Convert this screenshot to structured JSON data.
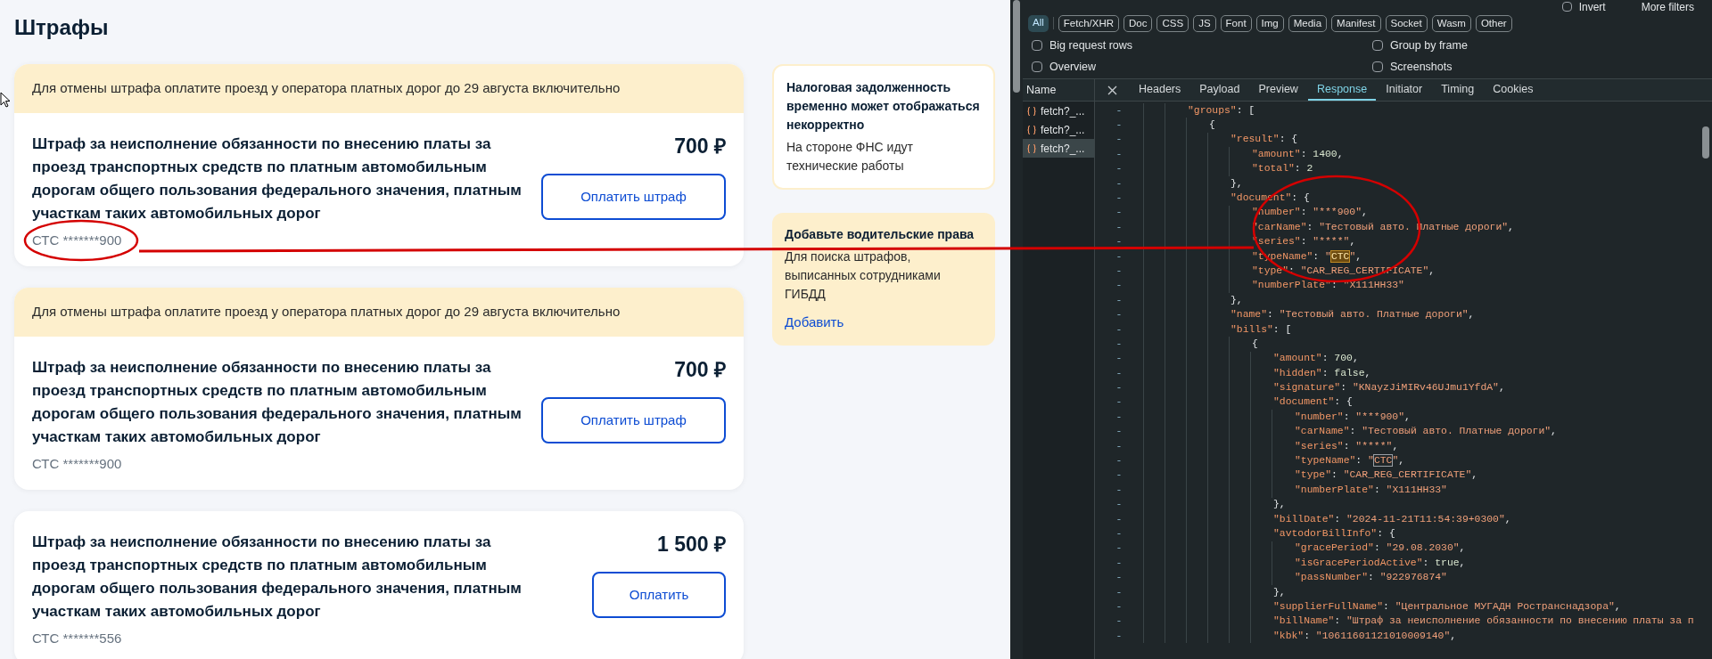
{
  "page": {
    "title": "Штрафы",
    "fines": [
      {
        "banner": "Для отмены штрафа оплатите проезд у оператора платных дорог до 29 августа включительно",
        "title": "Штраф за неисполнение обязанности по внесению платы за проезд транспортных средств по платным автомобильным дорогам общего пользования федерального значения, платным участкам таких автомобильных дорог",
        "amount": "700 ₽",
        "button": "Оплатить штраф",
        "document": "СТС *******900"
      },
      {
        "banner": "Для отмены штрафа оплатите проезд у оператора платных дорог до 29 августа включительно",
        "title": "Штраф за неисполнение обязанности по внесению платы за проезд транспортных средств по платным автомобильным дорогам общего пользования федерального значения, платным участкам таких автомобильных дорог",
        "amount": "700 ₽",
        "button": "Оплатить штраф",
        "document": "СТС *******900"
      },
      {
        "title": "Штраф за неисполнение обязанности по внесению платы за проезд транспортных средств по платным автомобильным дорогам общего пользования федерального значения, платным участкам таких автомобильных дорог",
        "amount": "1 500 ₽",
        "button": "Оплатить",
        "document": "СТС *******556"
      }
    ],
    "side_cards": [
      {
        "kind": "notice",
        "title": "Налоговая задолженность временно может отображаться некорректно",
        "text": "На стороне ФНС идут технические работы"
      },
      {
        "kind": "action",
        "title": "Добавьте водительские права",
        "text": "Для поиска штрафов, выписанных сотрудниками ГИБДД",
        "link": "Добавить"
      }
    ]
  },
  "devtools": {
    "filter": {
      "invert": {
        "label": "Invert",
        "checked": false
      },
      "more_filters": "More filters"
    },
    "type_filters": [
      {
        "label": "All",
        "selected": true
      },
      {
        "label": "Fetch/XHR",
        "selected": false
      },
      {
        "label": "Doc",
        "selected": false
      },
      {
        "label": "CSS",
        "selected": false
      },
      {
        "label": "JS",
        "selected": false
      },
      {
        "label": "Font",
        "selected": false
      },
      {
        "label": "Img",
        "selected": false
      },
      {
        "label": "Media",
        "selected": false
      },
      {
        "label": "Manifest",
        "selected": false
      },
      {
        "label": "Socket",
        "selected": false
      },
      {
        "label": "Wasm",
        "selected": false
      },
      {
        "label": "Other",
        "selected": false
      }
    ],
    "options": [
      {
        "label": "Big request rows",
        "checked": false
      },
      {
        "label": "Group by frame",
        "checked": false
      },
      {
        "label": "Overview",
        "checked": false
      },
      {
        "label": "Screenshots",
        "checked": false
      }
    ],
    "name_header": "Name",
    "requests": [
      {
        "name": "fetch?_...",
        "selected": false
      },
      {
        "name": "fetch?_...",
        "selected": false
      },
      {
        "name": "fetch?_...",
        "selected": true
      }
    ],
    "tabs": [
      {
        "label": "Headers",
        "selected": false
      },
      {
        "label": "Payload",
        "selected": false
      },
      {
        "label": "Preview",
        "selected": false
      },
      {
        "label": "Response",
        "selected": true
      },
      {
        "label": "Initiator",
        "selected": false
      },
      {
        "label": "Timing",
        "selected": false
      },
      {
        "label": "Cookies",
        "selected": false
      }
    ],
    "response_lines": [
      {
        "gutter": "-",
        "tokens": [
          {
            "kind": "key",
            "text": "\"groups\""
          },
          {
            "kind": "punct",
            "text": ": ["
          }
        ],
        "children": [
          {
            "gutter": "-",
            "tokens": [
              {
                "kind": "punct",
                "text": "{"
              }
            ],
            "children": [
              {
                "gutter": "-",
                "tokens": [
                  {
                    "kind": "key",
                    "text": "\"result\""
                  },
                  {
                    "kind": "punct",
                    "text": ": {"
                  }
                ],
                "children": [
                  {
                    "gutter": "-",
                    "tokens": [
                      {
                        "kind": "key",
                        "text": "\"amount\""
                      },
                      {
                        "kind": "punct",
                        "text": ": "
                      },
                      {
                        "kind": "number",
                        "text": "1400"
                      },
                      {
                        "kind": "punct",
                        "text": ","
                      }
                    ]
                  },
                  {
                    "gutter": "-",
                    "tokens": [
                      {
                        "kind": "key",
                        "text": "\"total\""
                      },
                      {
                        "kind": "punct",
                        "text": ": "
                      },
                      {
                        "kind": "number",
                        "text": "2"
                      }
                    ]
                  }
                ]
              },
              {
                "gutter": "-",
                "tokens": [
                  {
                    "kind": "punct",
                    "text": "},"
                  }
                ]
              },
              {
                "gutter": "-",
                "tokens": [
                  {
                    "kind": "key",
                    "text": "\"document\""
                  },
                  {
                    "kind": "punct",
                    "text": ": {"
                  }
                ],
                "children": [
                  {
                    "gutter": "-",
                    "tokens": [
                      {
                        "kind": "key",
                        "text": "\"number\""
                      },
                      {
                        "kind": "punct",
                        "text": ": "
                      },
                      {
                        "kind": "string",
                        "text": "\"***900\""
                      },
                      {
                        "kind": "punct",
                        "text": ","
                      }
                    ]
                  },
                  {
                    "gutter": "-",
                    "tokens": [
                      {
                        "kind": "key",
                        "text": "\"carName\""
                      },
                      {
                        "kind": "punct",
                        "text": ": "
                      },
                      {
                        "kind": "string",
                        "text": "\"Тестовый авто. Платные дороги\""
                      },
                      {
                        "kind": "punct",
                        "text": ","
                      }
                    ]
                  },
                  {
                    "gutter": "-",
                    "tokens": [
                      {
                        "kind": "key",
                        "text": "\"series\""
                      },
                      {
                        "kind": "punct",
                        "text": ": "
                      },
                      {
                        "kind": "string",
                        "text": "\"****\""
                      },
                      {
                        "kind": "punct",
                        "text": ","
                      }
                    ]
                  },
                  {
                    "gutter": "-",
                    "tokens": [
                      {
                        "kind": "key",
                        "text": "\"typeName\""
                      },
                      {
                        "kind": "punct",
                        "text": ": "
                      },
                      {
                        "kind": "string",
                        "text": "\""
                      },
                      {
                        "kind": "match",
                        "text": "СТС",
                        "current": true
                      },
                      {
                        "kind": "string",
                        "text": "\""
                      },
                      {
                        "kind": "punct",
                        "text": ","
                      }
                    ]
                  },
                  {
                    "gutter": "-",
                    "tokens": [
                      {
                        "kind": "key",
                        "text": "\"type\""
                      },
                      {
                        "kind": "punct",
                        "text": ": "
                      },
                      {
                        "kind": "string",
                        "text": "\"CAR_REG_CERTIFICATE\""
                      },
                      {
                        "kind": "punct",
                        "text": ","
                      }
                    ]
                  },
                  {
                    "gutter": "-",
                    "tokens": [
                      {
                        "kind": "key",
                        "text": "\"numberPlate\""
                      },
                      {
                        "kind": "punct",
                        "text": ": "
                      },
                      {
                        "kind": "string",
                        "text": "\"X111HH33\""
                      }
                    ]
                  }
                ]
              },
              {
                "gutter": "-",
                "tokens": [
                  {
                    "kind": "punct",
                    "text": "},"
                  }
                ]
              },
              {
                "gutter": "-",
                "tokens": [
                  {
                    "kind": "key",
                    "text": "\"name\""
                  },
                  {
                    "kind": "punct",
                    "text": ": "
                  },
                  {
                    "kind": "string",
                    "text": "\"Тестовый авто. Платные дороги\""
                  },
                  {
                    "kind": "punct",
                    "text": ","
                  }
                ]
              },
              {
                "gutter": "-",
                "tokens": [
                  {
                    "kind": "key",
                    "text": "\"bills\""
                  },
                  {
                    "kind": "punct",
                    "text": ": ["
                  }
                ],
                "children": [
                  {
                    "gutter": "-",
                    "tokens": [
                      {
                        "kind": "punct",
                        "text": "{"
                      }
                    ],
                    "children": [
                      {
                        "gutter": "-",
                        "tokens": [
                          {
                            "kind": "key",
                            "text": "\"amount\""
                          },
                          {
                            "kind": "punct",
                            "text": ": "
                          },
                          {
                            "kind": "number",
                            "text": "700"
                          },
                          {
                            "kind": "punct",
                            "text": ","
                          }
                        ]
                      },
                      {
                        "gutter": "-",
                        "tokens": [
                          {
                            "kind": "key",
                            "text": "\"hidden\""
                          },
                          {
                            "kind": "punct",
                            "text": ": "
                          },
                          {
                            "kind": "number",
                            "text": "false"
                          },
                          {
                            "kind": "punct",
                            "text": ","
                          }
                        ]
                      },
                      {
                        "gutter": "-",
                        "tokens": [
                          {
                            "kind": "key",
                            "text": "\"signature\""
                          },
                          {
                            "kind": "punct",
                            "text": ": "
                          },
                          {
                            "kind": "string",
                            "text": "\"KNayzJiMIRv46UJmu1YfdA\""
                          },
                          {
                            "kind": "punct",
                            "text": ","
                          }
                        ]
                      },
                      {
                        "gutter": "-",
                        "tokens": [
                          {
                            "kind": "key",
                            "text": "\"document\""
                          },
                          {
                            "kind": "punct",
                            "text": ": {"
                          }
                        ],
                        "children": [
                          {
                            "gutter": "-",
                            "tokens": [
                              {
                                "kind": "key",
                                "text": "\"number\""
                              },
                              {
                                "kind": "punct",
                                "text": ": "
                              },
                              {
                                "kind": "string",
                                "text": "\"***900\""
                              },
                              {
                                "kind": "punct",
                                "text": ","
                              }
                            ]
                          },
                          {
                            "gutter": "-",
                            "tokens": [
                              {
                                "kind": "key",
                                "text": "\"carName\""
                              },
                              {
                                "kind": "punct",
                                "text": ": "
                              },
                              {
                                "kind": "string",
                                "text": "\"Тестовый авто. Платные дороги\""
                              },
                              {
                                "kind": "punct",
                                "text": ","
                              }
                            ]
                          },
                          {
                            "gutter": "-",
                            "tokens": [
                              {
                                "kind": "key",
                                "text": "\"series\""
                              },
                              {
                                "kind": "punct",
                                "text": ": "
                              },
                              {
                                "kind": "string",
                                "text": "\"****\""
                              },
                              {
                                "kind": "punct",
                                "text": ","
                              }
                            ]
                          },
                          {
                            "gutter": "-",
                            "tokens": [
                              {
                                "kind": "key",
                                "text": "\"typeName\""
                              },
                              {
                                "kind": "punct",
                                "text": ": "
                              },
                              {
                                "kind": "string",
                                "text": "\""
                              },
                              {
                                "kind": "match",
                                "text": "СТС",
                                "current": false
                              },
                              {
                                "kind": "string",
                                "text": "\""
                              },
                              {
                                "kind": "punct",
                                "text": ","
                              }
                            ]
                          },
                          {
                            "gutter": "-",
                            "tokens": [
                              {
                                "kind": "key",
                                "text": "\"type\""
                              },
                              {
                                "kind": "punct",
                                "text": ": "
                              },
                              {
                                "kind": "string",
                                "text": "\"CAR_REG_CERTIFICATE\""
                              },
                              {
                                "kind": "punct",
                                "text": ","
                              }
                            ]
                          },
                          {
                            "gutter": "-",
                            "tokens": [
                              {
                                "kind": "key",
                                "text": "\"numberPlate\""
                              },
                              {
                                "kind": "punct",
                                "text": ": "
                              },
                              {
                                "kind": "string",
                                "text": "\"X111HH33\""
                              }
                            ]
                          }
                        ]
                      },
                      {
                        "gutter": "-",
                        "tokens": [
                          {
                            "kind": "punct",
                            "text": "},"
                          }
                        ]
                      },
                      {
                        "gutter": "-",
                        "tokens": [
                          {
                            "kind": "key",
                            "text": "\"billDate\""
                          },
                          {
                            "kind": "punct",
                            "text": ": "
                          },
                          {
                            "kind": "string",
                            "text": "\"2024-11-21T11:54:39+0300\""
                          },
                          {
                            "kind": "punct",
                            "text": ","
                          }
                        ]
                      },
                      {
                        "gutter": "-",
                        "tokens": [
                          {
                            "kind": "key",
                            "text": "\"avtodorBillInfo\""
                          },
                          {
                            "kind": "punct",
                            "text": ": {"
                          }
                        ],
                        "children": [
                          {
                            "gutter": "-",
                            "tokens": [
                              {
                                "kind": "key",
                                "text": "\"gracePeriod\""
                              },
                              {
                                "kind": "punct",
                                "text": ": "
                              },
                              {
                                "kind": "string",
                                "text": "\"29.08.2030\""
                              },
                              {
                                "kind": "punct",
                                "text": ","
                              }
                            ]
                          },
                          {
                            "gutter": "-",
                            "tokens": [
                              {
                                "kind": "key",
                                "text": "\"isGracePeriodActive\""
                              },
                              {
                                "kind": "punct",
                                "text": ": "
                              },
                              {
                                "kind": "number",
                                "text": "true"
                              },
                              {
                                "kind": "punct",
                                "text": ","
                              }
                            ]
                          },
                          {
                            "gutter": "-",
                            "tokens": [
                              {
                                "kind": "key",
                                "text": "\"passNumber\""
                              },
                              {
                                "kind": "punct",
                                "text": ": "
                              },
                              {
                                "kind": "string",
                                "text": "\"922976874\""
                              }
                            ]
                          }
                        ]
                      },
                      {
                        "gutter": "-",
                        "tokens": [
                          {
                            "kind": "punct",
                            "text": "},"
                          }
                        ]
                      },
                      {
                        "gutter": "-",
                        "tokens": [
                          {
                            "kind": "key",
                            "text": "\"supplierFullName\""
                          },
                          {
                            "kind": "punct",
                            "text": ": "
                          },
                          {
                            "kind": "string",
                            "text": "\"Центральное МУГАДН Ространснадзора\""
                          },
                          {
                            "kind": "punct",
                            "text": ","
                          }
                        ]
                      },
                      {
                        "gutter": "-",
                        "tokens": [
                          {
                            "kind": "key",
                            "text": "\"billName\""
                          },
                          {
                            "kind": "punct",
                            "text": ": "
                          },
                          {
                            "kind": "string",
                            "text": "\"Штраф за неисполнение обязанности по внесению платы за п"
                          }
                        ]
                      },
                      {
                        "gutter": "-",
                        "tokens": [
                          {
                            "kind": "key",
                            "text": "\"kbk\""
                          },
                          {
                            "kind": "punct",
                            "text": ": "
                          },
                          {
                            "kind": "string",
                            "text": "\"10611601121010009140\""
                          },
                          {
                            "kind": "punct",
                            "text": ","
                          }
                        ]
                      }
                    ]
                  }
                ]
              }
            ]
          }
        ]
      }
    ]
  }
}
